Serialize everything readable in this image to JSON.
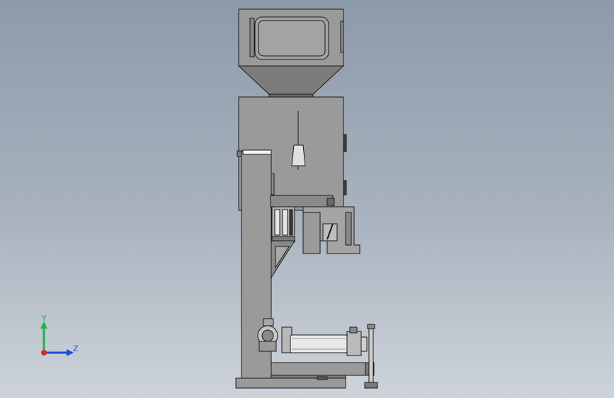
{
  "viewport": {
    "background_top": "#8d9aaa",
    "background_bottom": "#cdd3da"
  },
  "triad": {
    "y_label": "Y",
    "z_label": "Z",
    "y_color": "#22b14c",
    "z_color": "#1f4fd8",
    "x_color": "#d9262b"
  },
  "model": {
    "body_fill": "#9a9a9a",
    "steel_fill": "#c8c8c8",
    "dark_fill": "#5e5e5e",
    "edge_color": "#1a1a1a"
  }
}
